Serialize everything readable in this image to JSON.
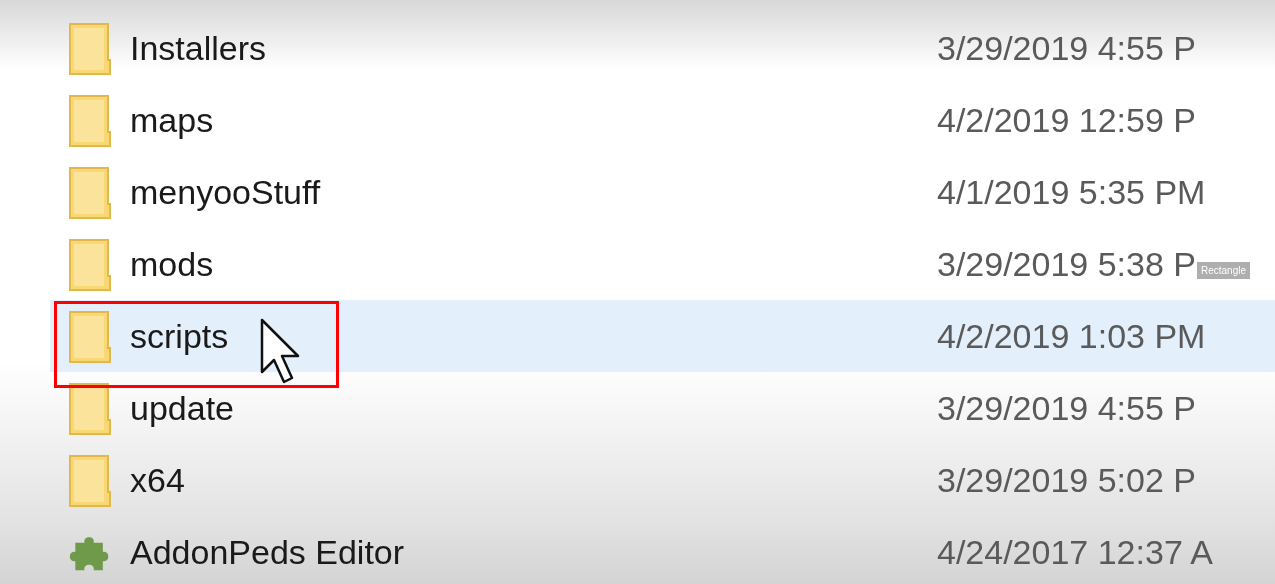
{
  "files": [
    {
      "name": "Installers",
      "modified": "3/29/2019 4:55 P",
      "kind": "folder",
      "selected": false
    },
    {
      "name": "maps",
      "modified": "4/2/2019 12:59 P",
      "kind": "folder",
      "selected": false
    },
    {
      "name": "menyooStuff",
      "modified": "4/1/2019 5:35 PM",
      "kind": "folder",
      "selected": false
    },
    {
      "name": "mods",
      "modified": "3/29/2019 5:38 P",
      "kind": "folder",
      "selected": false
    },
    {
      "name": "scripts",
      "modified": "4/2/2019 1:03 PM",
      "kind": "folder",
      "selected": true
    },
    {
      "name": "update",
      "modified": "3/29/2019 4:55 P",
      "kind": "folder",
      "selected": false
    },
    {
      "name": "x64",
      "modified": "3/29/2019 5:02 P",
      "kind": "folder",
      "selected": false
    },
    {
      "name": "AddonPeds Editor",
      "modified": "4/24/2017 12:37 A",
      "kind": "app",
      "selected": false
    }
  ],
  "tooltip": "Rectangle"
}
